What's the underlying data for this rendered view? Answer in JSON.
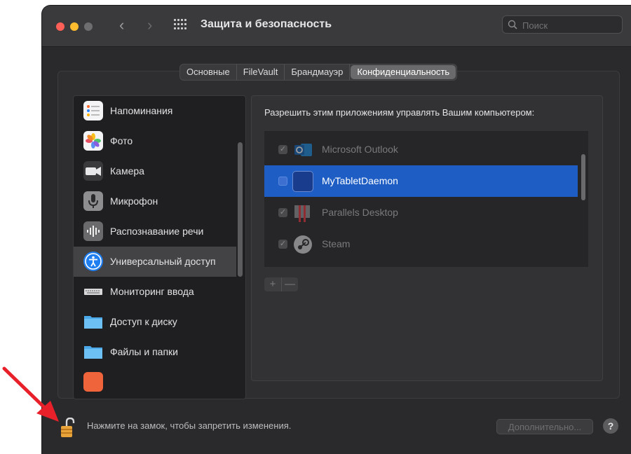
{
  "window": {
    "title": "Защита и безопасность",
    "search_placeholder": "Поиск"
  },
  "tabs": [
    {
      "label": "Основные",
      "active": false
    },
    {
      "label": "FileVault",
      "active": false
    },
    {
      "label": "Брандмауэр",
      "active": false
    },
    {
      "label": "Конфиденциальность",
      "active": true
    }
  ],
  "sidebar": {
    "items": [
      {
        "label": "Напоминания",
        "icon": "reminders-icon"
      },
      {
        "label": "Фото",
        "icon": "photos-icon"
      },
      {
        "label": "Камера",
        "icon": "camera-icon"
      },
      {
        "label": "Микрофон",
        "icon": "microphone-icon"
      },
      {
        "label": "Распознавание речи",
        "icon": "speech-recognition-icon"
      },
      {
        "label": "Универсальный доступ",
        "icon": "accessibility-icon",
        "selected": true
      },
      {
        "label": "Мониторинг ввода",
        "icon": "keyboard-icon"
      },
      {
        "label": "Доступ к диску",
        "icon": "folder-icon"
      },
      {
        "label": "Файлы и папки",
        "icon": "folder-icon"
      }
    ]
  },
  "content": {
    "heading": "Разрешить этим приложениям управлять Вашим компьютером:",
    "apps": [
      {
        "label": "Microsoft Outlook",
        "checked": true,
        "icon": "outlook-icon"
      },
      {
        "label": "MyTabletDaemon",
        "checked": false,
        "selected": true,
        "icon": "tablet-daemon-icon"
      },
      {
        "label": "Parallels Desktop",
        "checked": true,
        "icon": "parallels-icon"
      },
      {
        "label": "Steam",
        "checked": true,
        "icon": "steam-icon"
      }
    ],
    "add_label": "+",
    "remove_label": "—"
  },
  "footer": {
    "lock_text": "Нажмите на замок, чтобы запретить изменения.",
    "advanced_label": "Дополнительно...",
    "help_label": "?"
  },
  "colors": {
    "selection": "#1d5dc4",
    "annotation_arrow": "#e8202a",
    "lock": "#e8a33a"
  }
}
